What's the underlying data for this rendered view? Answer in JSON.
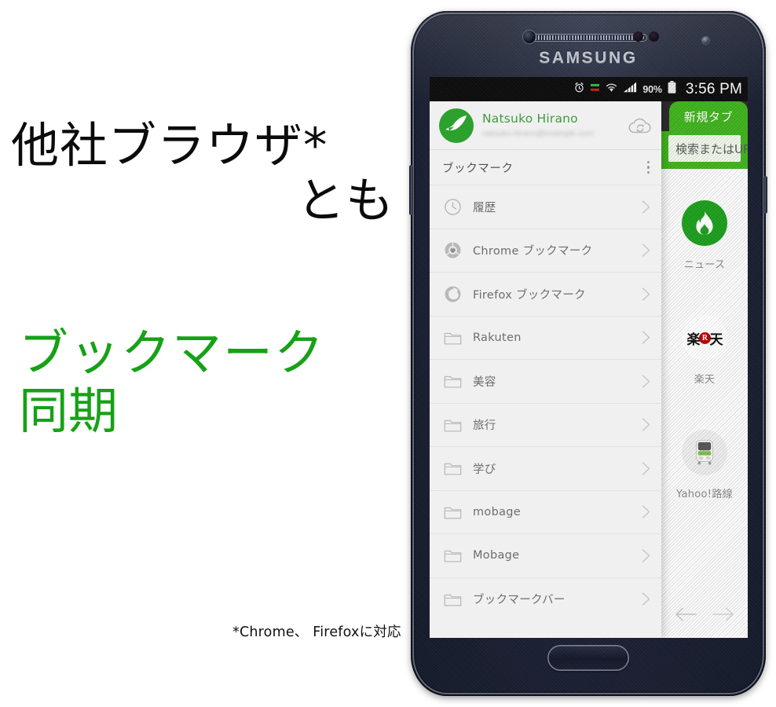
{
  "promo": {
    "headline_black_line1": "他社ブラウザ*",
    "headline_black_line2": "とも",
    "headline_green_line1": "ブックマーク",
    "headline_green_line2": "同期",
    "footnote": "*Chrome、 Firefoxに対応",
    "green_color": "#17a117",
    "black_color": "#0b0b0b"
  },
  "device": {
    "brand": "SAMSUNG"
  },
  "statusbar": {
    "alarm_icon": "alarm-clock-icon",
    "sync_icon": "sync-arrows-icon",
    "wifi_icon": "wifi-icon",
    "signal_icon": "signal-bars-icon",
    "battery_percent": "90%",
    "battery_icon": "battery-icon",
    "time": "3:56 PM"
  },
  "drawer": {
    "profile": {
      "avatar_icon": "dolphin-avatar-icon",
      "name": "Natsuko Hirano",
      "email_blurred": "natsuko.hirano@example.com",
      "sync_icon": "cloud-sync-icon"
    },
    "section_title": "ブックマーク",
    "overflow_icon": "kebab-menu-icon",
    "items": [
      {
        "label": "履歴",
        "icon": "clock-icon"
      },
      {
        "label": "Chrome ブックマーク",
        "icon": "chrome-icon"
      },
      {
        "label": "Firefox ブックマーク",
        "icon": "firefox-icon"
      },
      {
        "label": "Rakuten",
        "icon": "folder-icon"
      },
      {
        "label": "美容",
        "icon": "folder-icon"
      },
      {
        "label": "旅行",
        "icon": "folder-icon"
      },
      {
        "label": "学び",
        "icon": "folder-icon"
      },
      {
        "label": "mobage",
        "icon": "folder-icon"
      },
      {
        "label": "Mobage",
        "icon": "folder-icon"
      },
      {
        "label": "ブックマークバー",
        "icon": "folder-icon"
      }
    ],
    "chevron_icon": "chevron-right-icon"
  },
  "page": {
    "tab_label": "新規タブ",
    "url_placeholder": "検索またはURL",
    "accent_color": "#41b41f",
    "speed_dial": [
      {
        "label": "ニュース",
        "icon": "flame-icon"
      },
      {
        "label": "楽天",
        "icon": "rakuten-logo-icon",
        "logo_left": "楽",
        "logo_mid": "R",
        "logo_right": "天"
      },
      {
        "label": "Yahoo!路線",
        "icon": "train-icon"
      }
    ],
    "nav_back_icon": "arrow-left-icon",
    "nav_forward_icon": "arrow-right-icon"
  }
}
